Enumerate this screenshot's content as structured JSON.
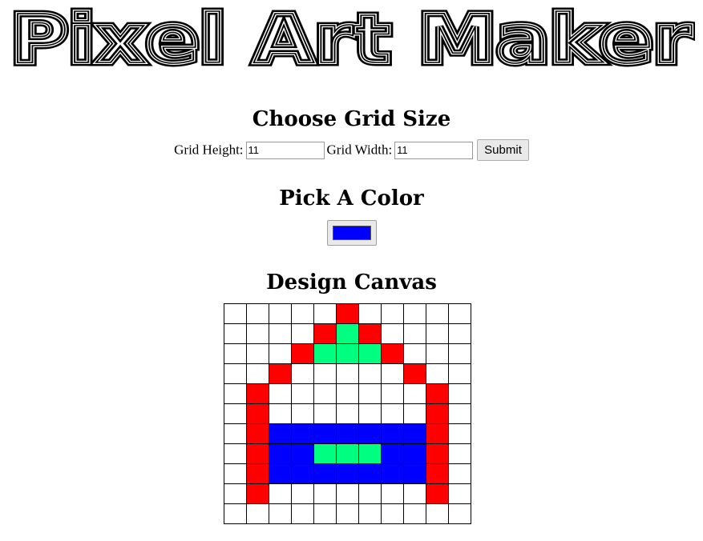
{
  "title": "Pixel Art Maker",
  "grid_section": {
    "heading": "Choose Grid Size",
    "height_label": "Grid Height:",
    "height_value": "11",
    "width_label": "Grid Width:",
    "width_value": "11",
    "submit_label": "Submit"
  },
  "color_section": {
    "heading": "Pick A Color",
    "selected_color": "#0000ff"
  },
  "canvas_section": {
    "heading": "Design Canvas",
    "palette": {
      "W": "#ffffff",
      "R": "#ff0000",
      "G": "#00ff80",
      "B": "#0000ff"
    },
    "rows": [
      "WWWWWRWWWWW",
      "WWWWRGRWWWW",
      "WWWRGGGRWWW",
      "WWRWWWWWRWW",
      "WRWWWWWWWRW",
      "WRWWWWWWWRW",
      "WRBBBBBBBRW",
      "WRBBGGGBBRW",
      "WRBBBBBBBRW",
      "WRWWWWWWWRW",
      "WWWWWWWWWWW"
    ]
  }
}
